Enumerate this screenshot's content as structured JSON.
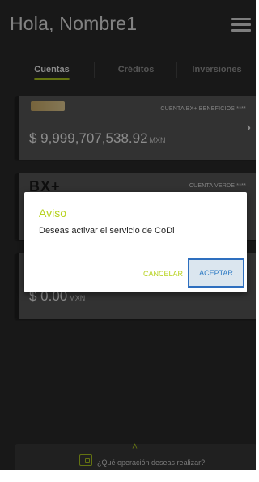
{
  "header": {
    "greeting": "Hola, Nombre1"
  },
  "tabs": [
    {
      "label": "Cuentas",
      "active": true
    },
    {
      "label": "Créditos",
      "active": false
    },
    {
      "label": "Inversiones",
      "active": false
    }
  ],
  "cards": [
    {
      "name": "CUENTA BX+ BENEFICIOS ****",
      "amount": "$ 9,999,707,538.92",
      "currency": "MXN"
    },
    {
      "name": "CUENTA VERDE ****",
      "logo": "BX+"
    },
    {
      "amount": "$ 0.00",
      "currency": "MXN"
    }
  ],
  "dialog": {
    "title": "Aviso",
    "message": "Deseas activar el servicio de CoDi",
    "cancel_label": "CANCELAR",
    "accept_label": "ACEPTAR"
  },
  "bottom_bar": {
    "prompt": "¿Qué operación deseas realizar?"
  },
  "colors": {
    "accent": "#b7d21f",
    "background": "#2d2d2d",
    "card": "#5b5b5b",
    "accept_border": "#2e6fbf"
  }
}
